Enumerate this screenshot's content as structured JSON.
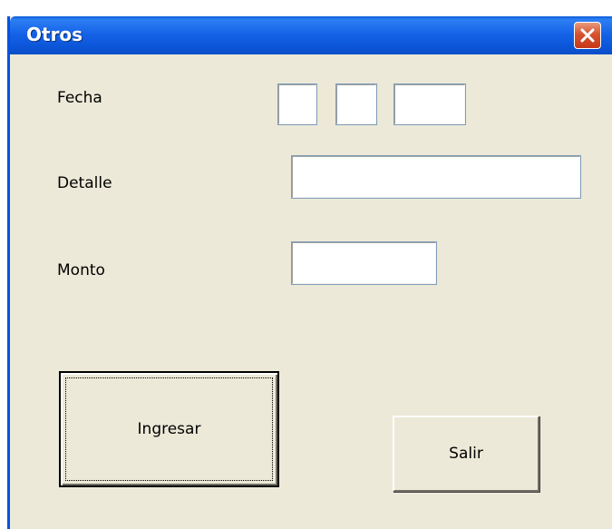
{
  "window": {
    "title": "Otros"
  },
  "form": {
    "fecha_label": "Fecha",
    "fecha_day": "",
    "fecha_month": "",
    "fecha_year": "",
    "detalle_label": "Detalle",
    "detalle_value": "",
    "monto_label": "Monto",
    "monto_value": ""
  },
  "buttons": {
    "ingresar_label": "Ingresar",
    "salir_label": "Salir"
  },
  "icons": {
    "close": "close-icon"
  },
  "colors": {
    "titlebar": "#0b55d8",
    "window_bg": "#ece9d8",
    "close_button": "#d8522e"
  }
}
